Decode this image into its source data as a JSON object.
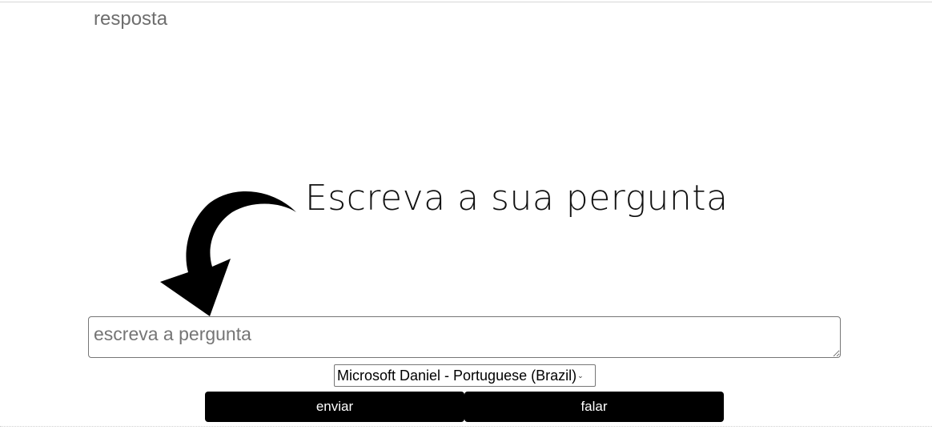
{
  "answer": {
    "text": "resposta"
  },
  "prompt": {
    "title": "Escreva a sua pergunta"
  },
  "question_input": {
    "placeholder": "escreva a pergunta",
    "value": ""
  },
  "voice_select": {
    "selected": "Microsoft Daniel - Portuguese (Brazil)"
  },
  "buttons": {
    "send_label": "enviar",
    "speak_label": "falar"
  },
  "icons": {
    "arrow": "curved-arrow-down-left-icon",
    "dropdown": "chevron-down-icon"
  },
  "colors": {
    "button_bg": "#000000",
    "button_text": "#ffffff",
    "answer_text": "#6e6e6e"
  }
}
